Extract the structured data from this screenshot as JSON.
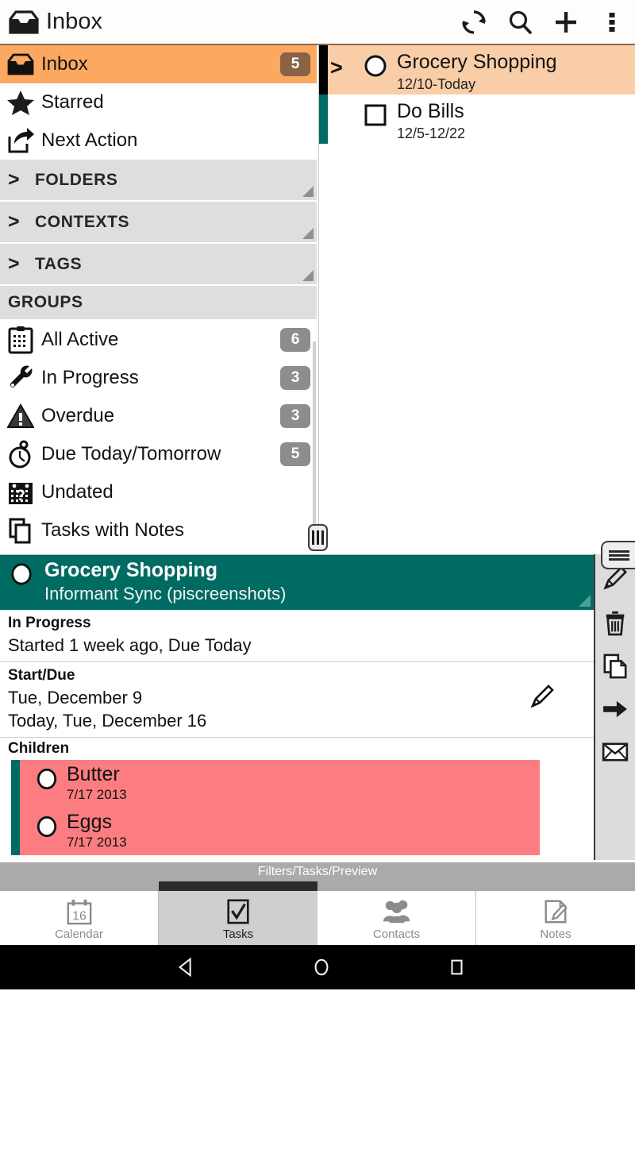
{
  "appbar": {
    "title": "Inbox",
    "icons": [
      {
        "name": "sync-icon",
        "label": "Sync"
      },
      {
        "name": "search-icon",
        "label": "Search"
      },
      {
        "name": "add-icon",
        "label": "Add"
      },
      {
        "name": "overflow-menu-icon",
        "label": "More options"
      }
    ]
  },
  "sidebar": {
    "filters": [
      {
        "icon": "inbox-icon",
        "label": "Inbox",
        "badge": "5",
        "selected": true
      },
      {
        "icon": "star-icon",
        "label": "Starred",
        "badge": "",
        "selected": false
      },
      {
        "icon": "next-action-icon",
        "label": "Next Action",
        "badge": "",
        "selected": false
      }
    ],
    "sections": [
      {
        "label": "FOLDERS",
        "chevron": ">"
      },
      {
        "label": "CONTEXTS",
        "chevron": ">"
      },
      {
        "label": "TAGS",
        "chevron": ">"
      }
    ],
    "groups_header": "GROUPS",
    "groups": [
      {
        "icon": "clipboard-icon",
        "label": "All Active",
        "badge": "6"
      },
      {
        "icon": "wrench-icon",
        "label": "In Progress",
        "badge": "3"
      },
      {
        "icon": "warning-icon",
        "label": "Overdue",
        "badge": "3"
      },
      {
        "icon": "stopwatch-icon",
        "label": "Due Today/Tomorrow",
        "badge": "5"
      },
      {
        "icon": "undated-calendar-icon",
        "label": "Undated",
        "badge": ""
      },
      {
        "icon": "notes-pages-icon",
        "label": "Tasks with Notes",
        "badge": ""
      }
    ]
  },
  "tasklist": {
    "items": [
      {
        "title": "Grocery Shopping",
        "date": "12/10-Today",
        "expand": ">",
        "selected": true,
        "marker": "circle"
      },
      {
        "title": "Do Bills",
        "date": "12/5-12/22",
        "expand": "",
        "selected": false,
        "marker": "square"
      }
    ]
  },
  "preview": {
    "header": {
      "title": "Grocery Shopping",
      "subtitle": "Informant Sync (piscreenshots)"
    },
    "status": {
      "heading": "In Progress",
      "line": "Started 1 week ago, Due Today"
    },
    "startdue": {
      "heading": "Start/Due",
      "line1": "Tue, December 9",
      "line2": "Today, Tue, December 16",
      "edit_icon": "pencil-icon"
    },
    "children": {
      "heading": "Children",
      "items": [
        {
          "title": "Butter",
          "date": "7/17 2013"
        },
        {
          "title": "Eggs",
          "date": "7/17 2013"
        }
      ]
    }
  },
  "actionbar": {
    "menu_icon": "hamburger-menu-icon",
    "buttons": [
      {
        "name": "edit-icon",
        "label": "Edit"
      },
      {
        "name": "delete-icon",
        "label": "Delete"
      },
      {
        "name": "copy-icon",
        "label": "Copy"
      },
      {
        "name": "move-icon",
        "label": "Move"
      },
      {
        "name": "mail-icon",
        "label": "Mail"
      }
    ]
  },
  "statusstrip": {
    "text": "Filters/Tasks/Preview"
  },
  "tabbar": {
    "tabs": [
      {
        "icon": "calendar-icon",
        "label": "Calendar",
        "active": false,
        "day": "16"
      },
      {
        "icon": "checkbox-check-icon",
        "label": "Tasks",
        "active": true
      },
      {
        "icon": "contacts-icon",
        "label": "Contacts",
        "active": false
      },
      {
        "icon": "notes-icon",
        "label": "Notes",
        "active": false
      }
    ]
  },
  "navbar": {
    "buttons": [
      {
        "name": "android-back-button",
        "label": "Back"
      },
      {
        "name": "android-home-button",
        "label": "Home"
      },
      {
        "name": "android-recents-button",
        "label": "Recents"
      }
    ]
  },
  "colors": {
    "accent_orange": "#fca861",
    "row_orange": "#f9cda7",
    "teal": "#006b63",
    "salmon": "#fb7d81",
    "section_gray": "#dedede",
    "badge_gray": "#8d8d8d",
    "badge_brown": "#8a6244"
  }
}
